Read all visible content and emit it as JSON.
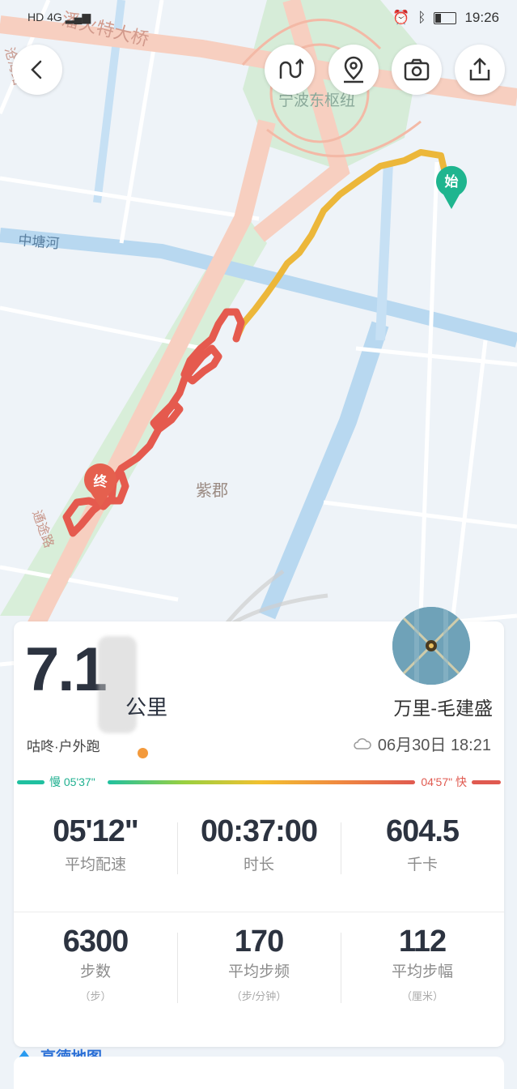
{
  "status_bar": {
    "left_text": "HD 4G",
    "time": "19:26"
  },
  "map": {
    "labels": [
      "潘火特大桥",
      "宁波东枢纽",
      "中塘河",
      "紫郡",
      "沧海路",
      "通途路"
    ],
    "start_marker": "始",
    "end_marker": "终"
  },
  "toolbar": {
    "icons": [
      "back-icon",
      "route-icon",
      "location-pin-icon",
      "camera-icon",
      "share-icon"
    ]
  },
  "summary": {
    "distance": "7.1",
    "distance_unit": "公里",
    "activity": "咕咚·户外跑",
    "username": "万里-毛建盛",
    "date_time": "06月30日 18:21"
  },
  "pace_legend": {
    "slow": "慢 05'37\"",
    "fast": "04'57\" 快"
  },
  "stats_row1": [
    {
      "value": "05'12\"",
      "label": "平均配速"
    },
    {
      "value": "00:37:00",
      "label": "时长"
    },
    {
      "value": "604.5",
      "label": "千卡"
    }
  ],
  "stats_row2": [
    {
      "value": "6300",
      "label": "步数",
      "unit": "（步）"
    },
    {
      "value": "170",
      "label": "平均步频",
      "unit": "（步/分钟）"
    },
    {
      "value": "112",
      "label": "平均步幅",
      "unit": "（厘米）"
    }
  ],
  "footer": {
    "logo_text": "高德地图"
  },
  "colors": {
    "route_fast": "#e55a4e",
    "route_slow": "#ecb73a",
    "start_marker": "#1fb58f",
    "end_marker": "#e5604e"
  }
}
